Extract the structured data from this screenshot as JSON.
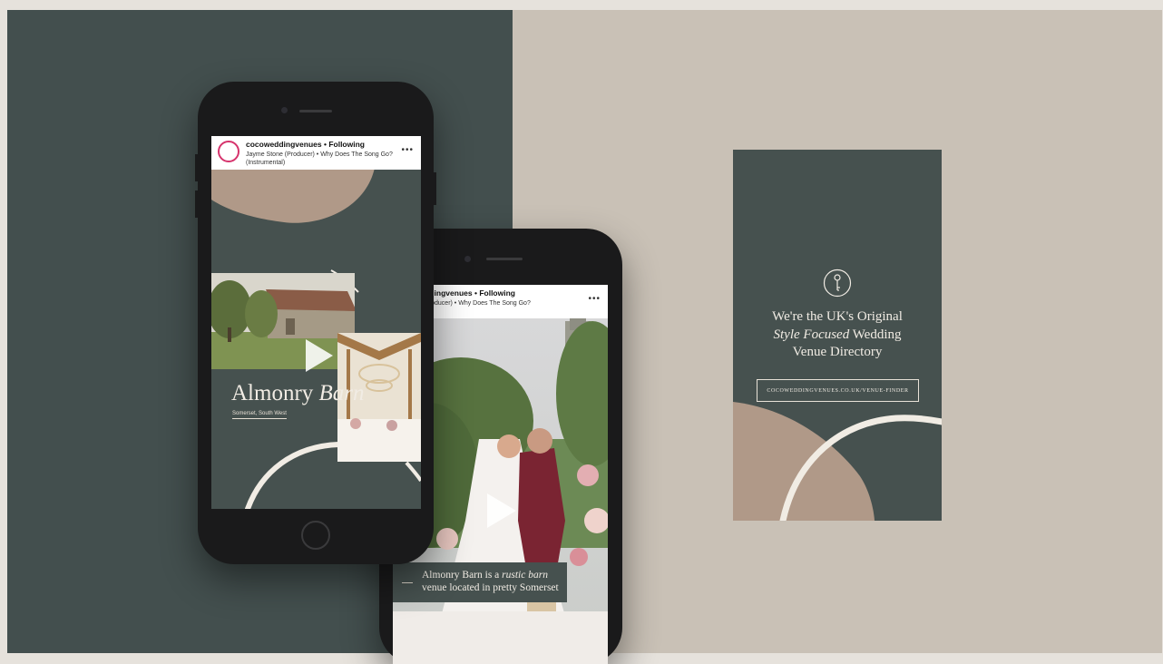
{
  "colors": {
    "dark_green": "#46514f",
    "left_bg": "#434f4e",
    "right_bg": "#c9c1b6",
    "blush": "#b09988",
    "cream": "#f1ece4"
  },
  "post_header": {
    "username": "cocoweddingvenues",
    "following": "• Following",
    "audio": "Jayme Stone (Producer) • Why Does The Song Go? (Instrumental)",
    "more_icon": "more-dots-icon",
    "avatar_icon": "key-logo-icon"
  },
  "phone1": {
    "venue_name_regular": "Almonry",
    "venue_name_italic": "Barn",
    "venue_location": "Somerset, South West",
    "play_icon": "play-icon"
  },
  "phone2": {
    "caption_line1_regular": "Almonry Barn is a",
    "caption_line1_italic": "rustic barn",
    "caption_line2": "venue located in pretty Somerset",
    "play_icon": "play-icon"
  },
  "story_card": {
    "logo_icon": "key-logo-icon",
    "line1": "We're the UK's Original",
    "line2_italic": "Style Focused",
    "line2_regular": "Wedding",
    "line3": "Venue Directory",
    "url": "COCOWEDDINGVENUES.CO.UK/VENUE-FINDER"
  }
}
